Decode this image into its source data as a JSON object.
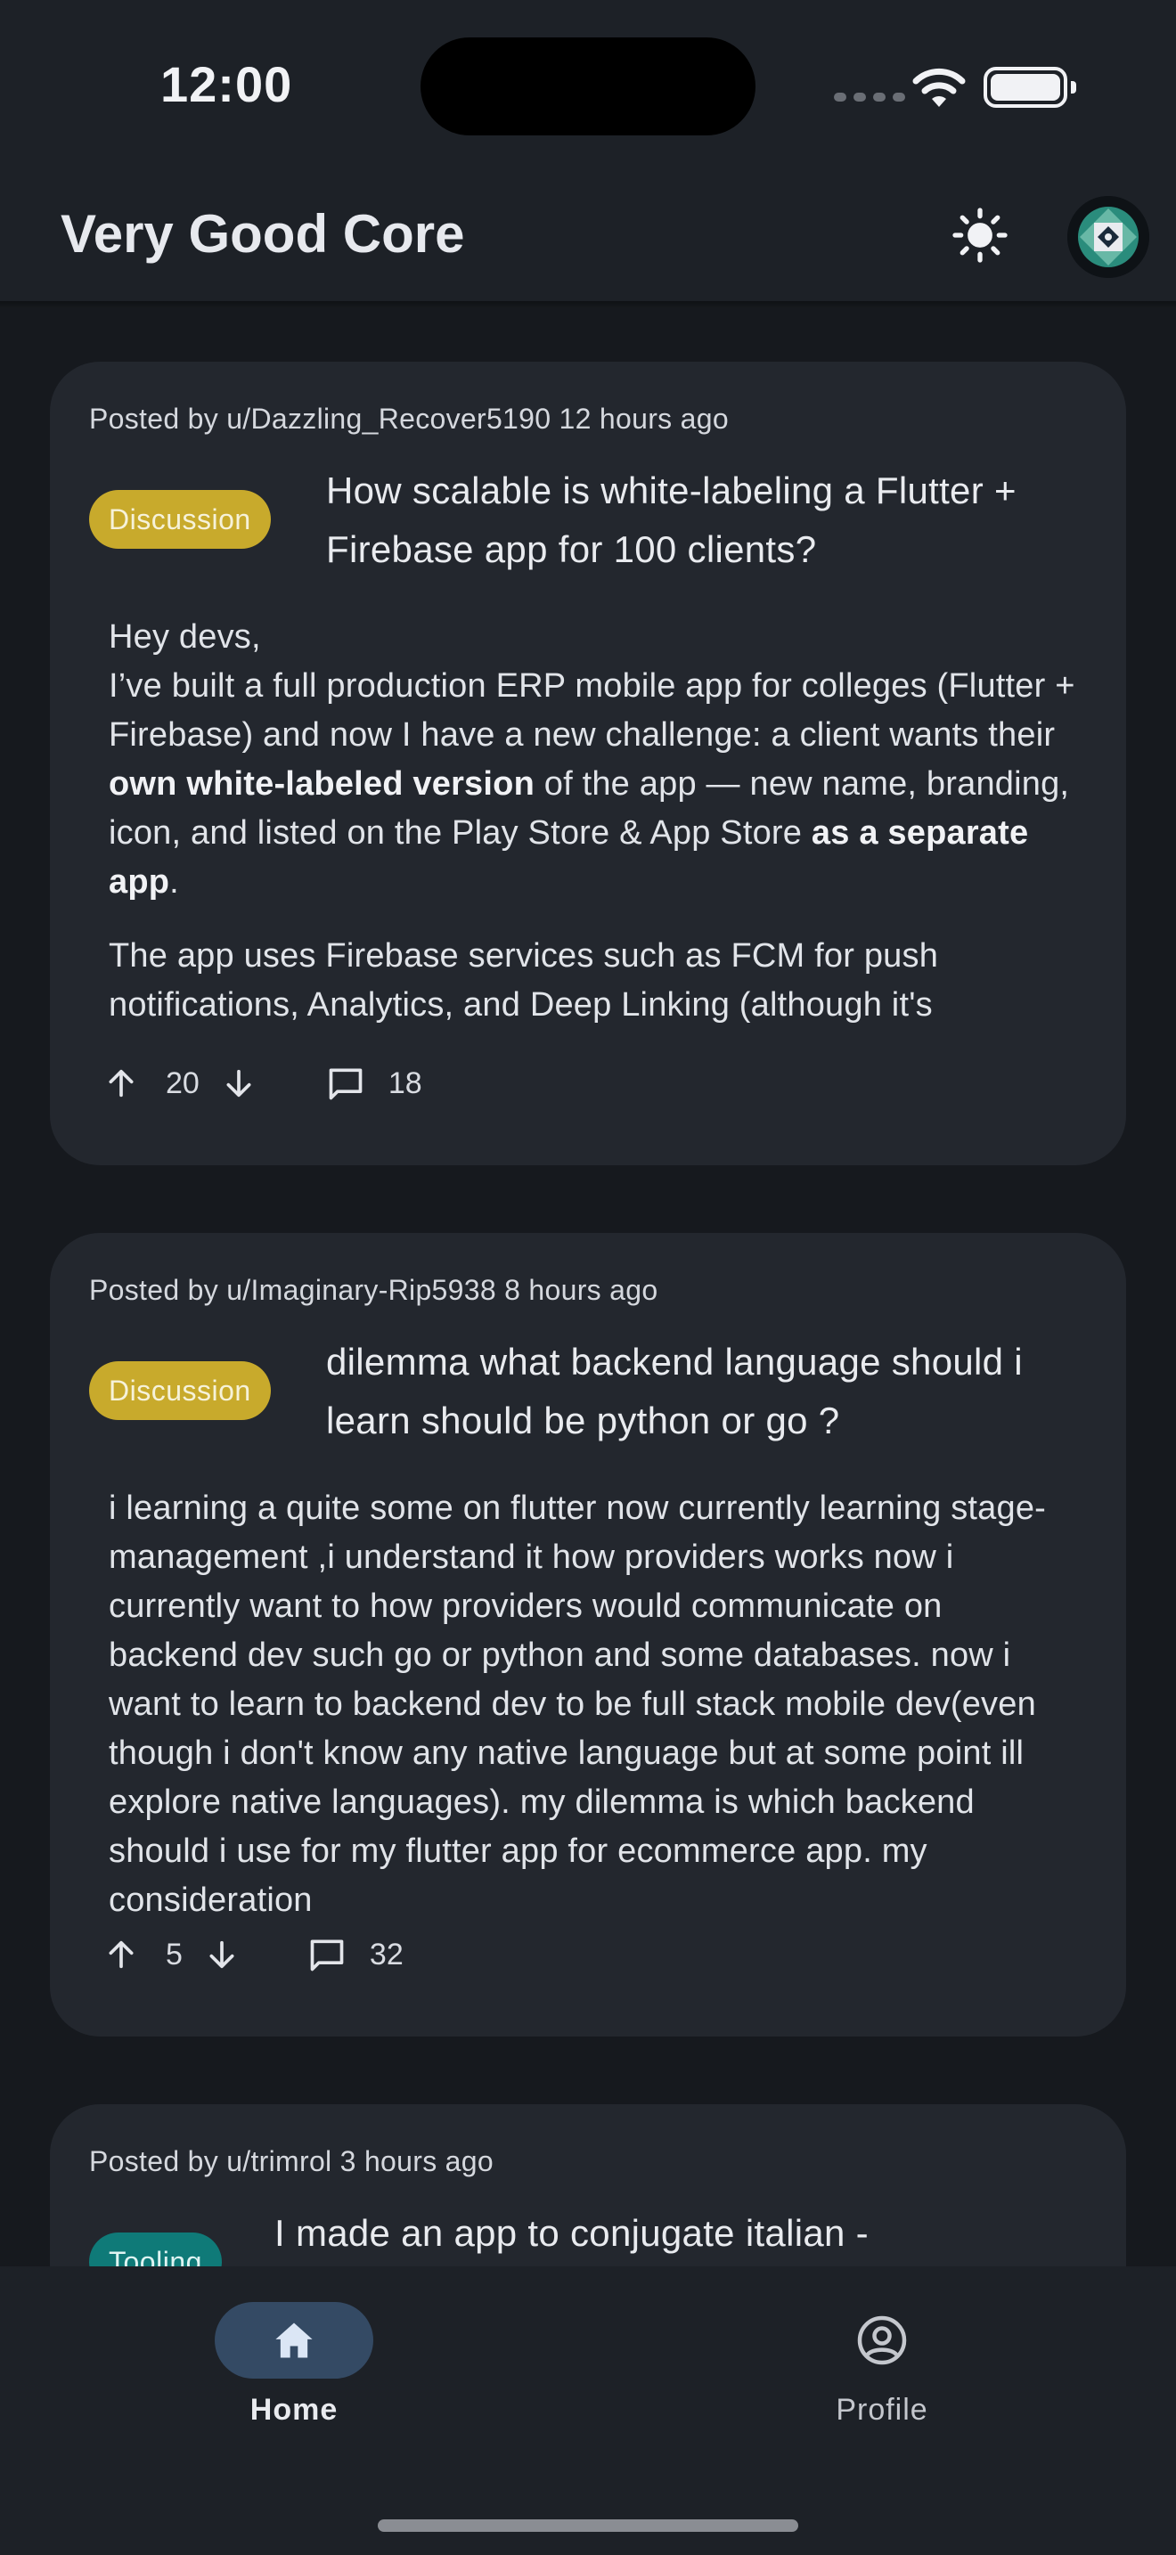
{
  "status_bar": {
    "time": "12:00"
  },
  "app_bar": {
    "title": "Very Good Core"
  },
  "posts": [
    {
      "meta": "Posted by u/Dazzling_Recover5190 12 hours ago",
      "tag": "Discussion",
      "title": "How scalable is white-labeling a Flutter + Firebase app for 100 clients?",
      "body": {
        "p1_l1": "Hey devs,",
        "p1_a": "I’ve built a full production ERP mobile app for colleges (Flutter + Firebase) and now I have a new challenge: a client wants their ",
        "p1_b1": "own white-labeled version",
        "p1_c": " of the app — new name, branding, icon, and listed on the Play Store & App Store ",
        "p1_b2": "as a separate app",
        "p1_d": ".",
        "p2": "The app uses Firebase services such as FCM for push notifications, Analytics, and Deep Linking (although it's deprecated and I haven't migrated to an alternative yet)."
      },
      "upvotes": "20",
      "comments": "18"
    },
    {
      "meta": "Posted by u/Imaginary-Rip5938 8 hours ago",
      "tag": "Discussion",
      "title": "dilemma what backend language should i learn should be python or go ?",
      "body": {
        "p1": "i learning a quite some on flutter now currently learning stage-management ,i understand it how providers works now i currently want to how providers would communicate on backend dev such go or python and some databases. now i want to learn to backend dev to be full stack mobile dev(even though i don't know any native language but at some point ill explore native languages). my dilemma is which backend should i use for my flutter app for ecommerce app. my consideration"
      },
      "upvotes": "5",
      "comments": "32"
    },
    {
      "meta": "Posted by u/trimrol 3 hours ago",
      "tag": "Tooling",
      "title": "I made an app to conjugate italian -"
    }
  ],
  "bottom_nav": {
    "items": [
      {
        "label": "Home",
        "icon": "home-icon",
        "active": true
      },
      {
        "label": "Profile",
        "icon": "profile-icon",
        "active": false
      }
    ]
  },
  "colors": {
    "background": "#16191e",
    "surface": "#23272e",
    "bar": "#1d2127",
    "discussion_tag": "#c8aa2c",
    "tooling_tag": "#0f7a78",
    "nav_active": "#344a64"
  }
}
